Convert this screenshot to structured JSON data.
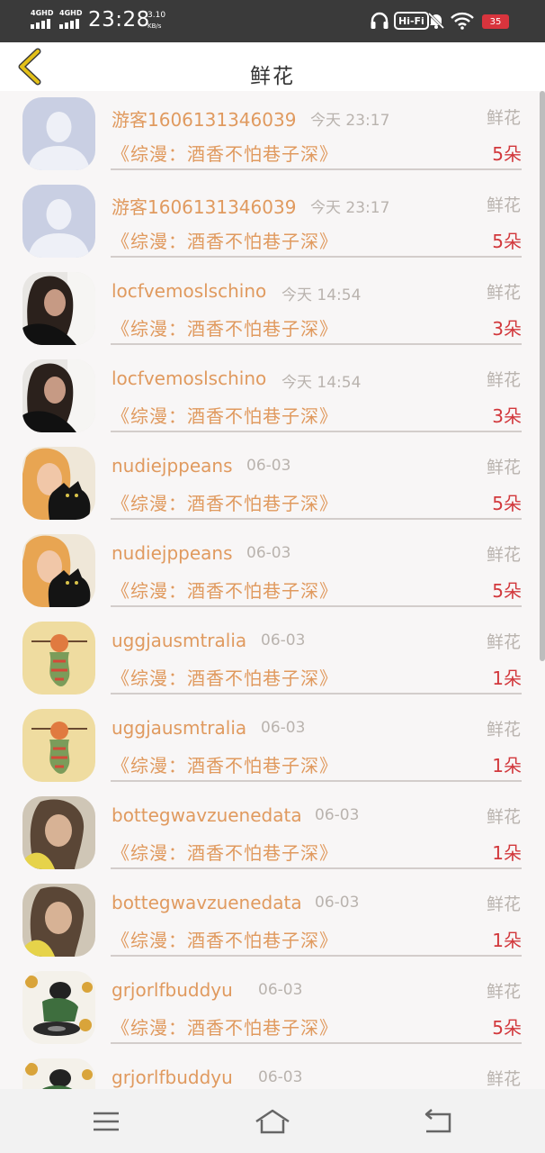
{
  "status_bar": {
    "network_1": "4GHD",
    "network_2": "4GHD",
    "time": "23:28",
    "speed_value": "3.10",
    "speed_unit": "KB/s",
    "hifi": "Hi-Fi",
    "battery": "35"
  },
  "header": {
    "title": "鲜花",
    "back_icon": "chevron-left-icon"
  },
  "colors": {
    "name": "#e09a5f",
    "count": "#d2383c",
    "muted": "#b9b3ae",
    "back_arrow": "#e3c018"
  },
  "items": [
    {
      "name": "游客1606131346039",
      "time": "今天 23:17",
      "tag": "鲜花",
      "book": "《综漫：酒香不怕巷子深》",
      "count": "5朵",
      "avatar": "default-avatar"
    },
    {
      "name": "游客1606131346039",
      "time": "今天 23:17",
      "tag": "鲜花",
      "book": "《综漫：酒香不怕巷子深》",
      "count": "5朵",
      "avatar": "default-avatar"
    },
    {
      "name": "locfvemoslschino",
      "time": "今天 14:54",
      "tag": "鲜花",
      "book": "《综漫：酒香不怕巷子深》",
      "count": "3朵",
      "avatar": "photo-woman-dark-hair"
    },
    {
      "name": "locfvemoslschino",
      "time": "今天 14:54",
      "tag": "鲜花",
      "book": "《综漫：酒香不怕巷子深》",
      "count": "3朵",
      "avatar": "photo-woman-dark-hair"
    },
    {
      "name": "nudiejppeans",
      "time": "06-03",
      "tag": "鲜花",
      "book": "《综漫：酒香不怕巷子深》",
      "count": "5朵",
      "avatar": "photo-woman-with-cat"
    },
    {
      "name": "nudiejppeans",
      "time": "06-03",
      "tag": "鲜花",
      "book": "《综漫：酒香不怕巷子深》",
      "count": "5朵",
      "avatar": "photo-woman-with-cat"
    },
    {
      "name": "uggjausmtralia",
      "time": "06-03",
      "tag": "鲜花",
      "book": "《综漫：酒香不怕巷子深》",
      "count": "1朵",
      "avatar": "sagittarius-illustration"
    },
    {
      "name": "uggjausmtralia",
      "time": "06-03",
      "tag": "鲜花",
      "book": "《综漫：酒香不怕巷子深》",
      "count": "1朵",
      "avatar": "sagittarius-illustration"
    },
    {
      "name": "bottegwavzuenedata",
      "time": "06-03",
      "tag": "鲜花",
      "book": "《综漫：酒香不怕巷子深》",
      "count": "1朵",
      "avatar": "photo-woman-blonde"
    },
    {
      "name": "bottegwavzuenedata",
      "time": "06-03",
      "tag": "鲜花",
      "book": "《综漫：酒香不怕巷子深》",
      "count": "1朵",
      "avatar": "photo-woman-blonde"
    },
    {
      "name": "grjorlfbuddyu",
      "time": "06-03",
      "tag": "鲜花",
      "book": "《综漫：酒香不怕巷子深》",
      "count": "5朵",
      "avatar": "dj-illustration"
    },
    {
      "name": "grjorlfbuddyu",
      "time": "06-03",
      "tag": "鲜花",
      "book": "",
      "count": "",
      "avatar": "dj-illustration"
    }
  ],
  "nav_bar": {
    "menu_icon": "menu-icon",
    "home_icon": "home-icon",
    "back_icon": "back-icon"
  }
}
